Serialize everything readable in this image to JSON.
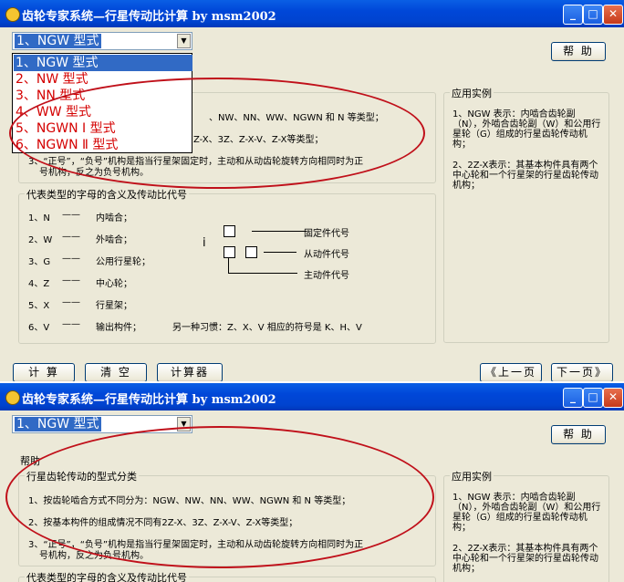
{
  "window": {
    "title": "齿轮专家系统—行星传动比计算  by  msm2002",
    "minimize": "_",
    "maximize": "□",
    "close": "✕"
  },
  "combo": {
    "value": "1、NGW 型式"
  },
  "dropdown": [
    "1、NGW 型式",
    "2、NW 型式",
    "3、NN 型式",
    "4、WW 型式",
    "5、NGWN Ⅰ 型式",
    "6、NGWN Ⅱ 型式"
  ],
  "buttons": {
    "help": "帮 助",
    "calc": "计 算",
    "clear": "清 空",
    "calculator": "计算器",
    "prev": "《上一页",
    "next": "下一页》"
  },
  "help_label": "帮助",
  "types_group": {
    "title": "行星齿轮传动的型式分类",
    "item1": "1、按齿轮啮合方式不同分为：NGW、NW、NN、WW、NGWN 和 N 等类型；",
    "item1_visible": "、NW、NN、WW、NGWN 和 N 等类型；",
    "item2": "2、按基本构件的组成情况不同有2Z-X、3Z、Z-X-V、Z-X等类型；",
    "item2_visible": "Z-X、3Z、Z-X-V、Z-X等类型；",
    "item3_line1": "3、“正号”，“负号”机构是指当行星架固定时，主动和从动齿轮旋转方向相同时为正",
    "item3_line1_visible": "3、“正号”，“负号”机构是指当行星架固定时，主动和从动齿轮旋转方向相同时为正",
    "item3_line2": "号机构，反之为负号机构。"
  },
  "letters_group": {
    "title": "代表类型的字母的含义及传动比代号",
    "rows": [
      {
        "code": "1、N",
        "dash": "——",
        "meaning": "内啮合；"
      },
      {
        "code": "2、W",
        "dash": "——",
        "meaning": "外啮合；"
      },
      {
        "code": "3、G",
        "dash": "——",
        "meaning": "公用行星轮；"
      },
      {
        "code": "4、Z",
        "dash": "——",
        "meaning": "中心轮；"
      },
      {
        "code": "5、X",
        "dash": "——",
        "meaning": "行星架；"
      },
      {
        "code": "6、V",
        "dash": "——",
        "meaning": "输出构件；"
      }
    ],
    "alt_habit": "另一种习惯：Z、X、V 相应的符号是 K、H、V",
    "symbol_i": "i",
    "fixed_label": "固定件代号",
    "driven_label": "从动件代号",
    "driver_label": "主动件代号"
  },
  "examples_group": {
    "title": "应用实例",
    "para1": "1、NGW 表示：内啮合齿轮副（N），外啮合齿轮副（W）和公用行星轮（G）组成的行星齿轮传动机构；",
    "para2": "2、2Z-X表示：其基本构件具有两个中心轮和一个行星架的行星齿轮传动机构；"
  },
  "colors": {
    "title_bar": "#0054e3",
    "selection": "#316ac5",
    "dropdown_text": "#d40000",
    "annotation": "#c0101a"
  }
}
